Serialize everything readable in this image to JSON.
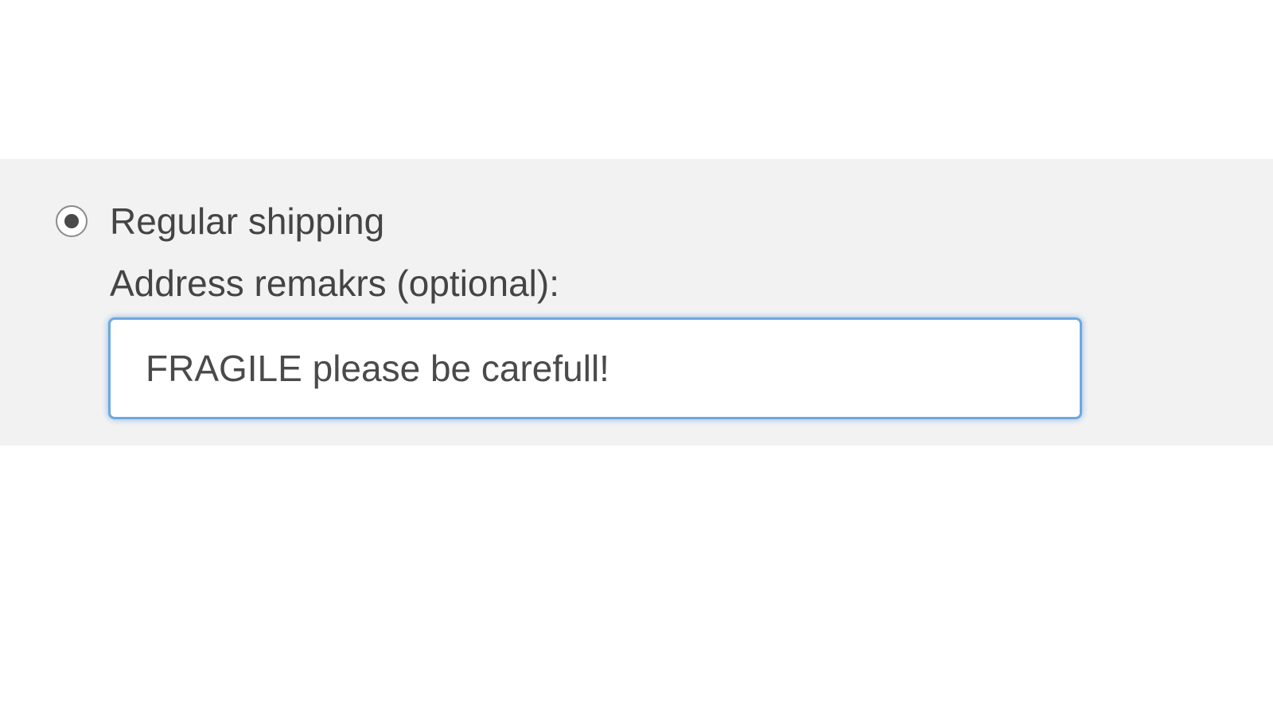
{
  "shipping": {
    "option_label": "Regular shipping",
    "option_selected": true,
    "remarks_label": "Address remakrs (optional):",
    "remarks_value": "FRAGILE please be carefull!"
  }
}
